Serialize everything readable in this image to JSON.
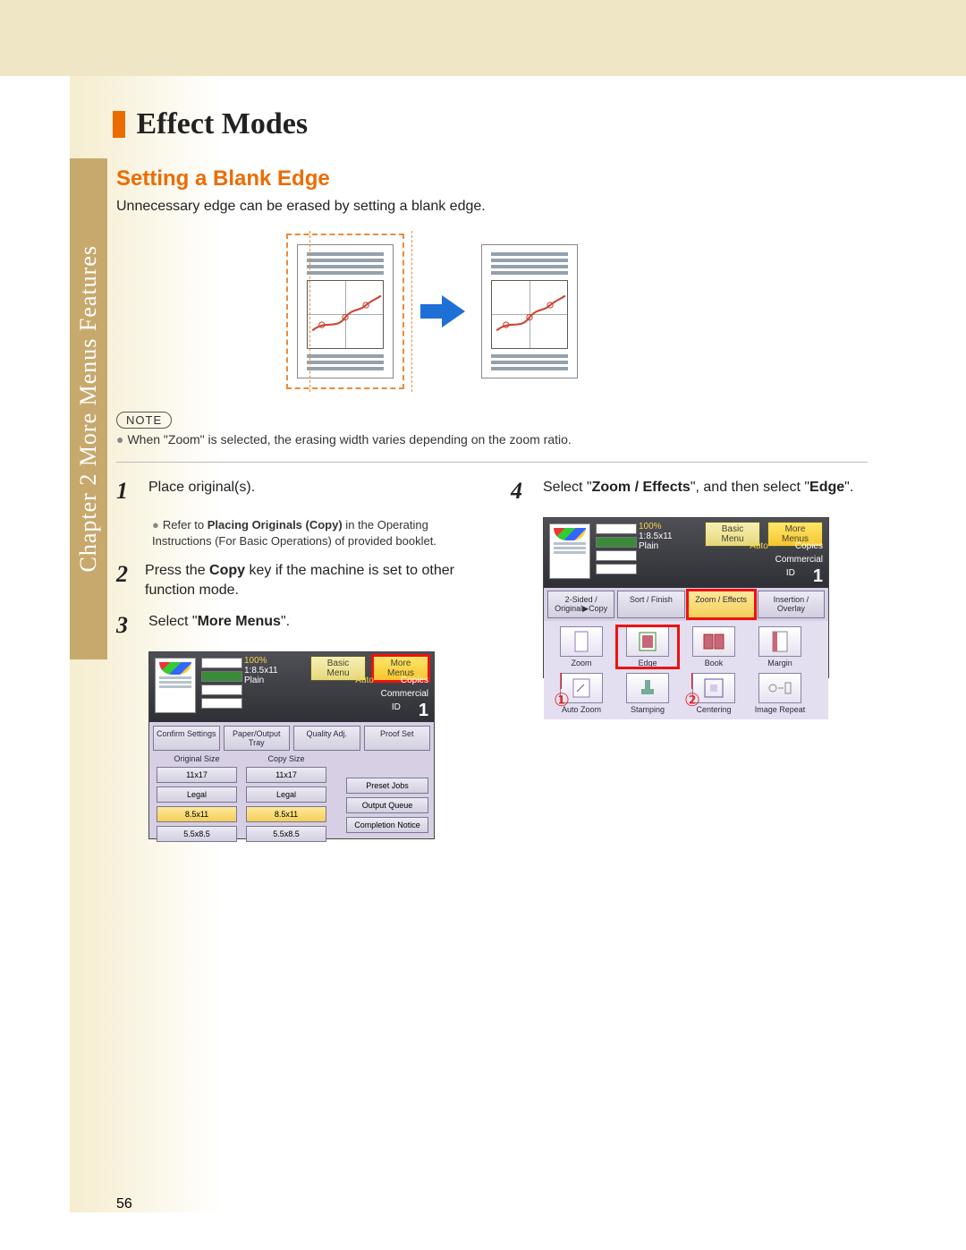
{
  "chapter_tab": "Chapter 2    More Menus Features",
  "heading": "Effect Modes",
  "subheading": "Setting a Blank Edge",
  "intro": "Unnecessary edge can be erased by setting a blank edge.",
  "note_badge": "NOTE",
  "note_line": "When \"Zoom\" is selected, the erasing width varies depending on the zoom ratio.",
  "steps": {
    "s1": {
      "num": "1",
      "text": "Place original(s)."
    },
    "s1_sub_prefix": "Refer to ",
    "s1_sub_strong": "Placing Originals (Copy)",
    "s1_sub_suffix": " in the Operating Instructions (For Basic Operations) of provided booklet.",
    "s2": {
      "num": "2",
      "text_a": "Press the ",
      "text_bold": "Copy",
      "text_b": " key if the machine is set to other function mode."
    },
    "s3": {
      "num": "3",
      "text_a": "Select \"",
      "text_bold": "More Menus",
      "text_b": "\"."
    },
    "s4": {
      "num": "4",
      "text_a": "Select \"",
      "text_bold1": "Zoom / Effects",
      "text_mid": "\", and then select \"",
      "text_bold2": "Edge",
      "text_b": "\"."
    }
  },
  "screenshot_a": {
    "zoom": "100%",
    "paper": "1:8.5x11",
    "plain": "Plain",
    "basic_menu": "Basic Menu",
    "more_menus": "More Menus",
    "auto": "Auto",
    "copies": "Copies",
    "commercial": "Commercial",
    "id": "ID",
    "count": "1",
    "row": {
      "confirm": "Confirm Settings",
      "paper_output": "Paper/Output Tray",
      "quality": "Quality Adj.",
      "proof": "Proof Set"
    },
    "orig_label": "Original Size",
    "copy_label": "Copy Size",
    "sizes": [
      "11x17",
      "Legal",
      "8.5x11",
      "5.5x8.5"
    ],
    "right_list": [
      "Preset Jobs",
      "Output Queue",
      "Completion Notice"
    ]
  },
  "screenshot_b": {
    "zoom": "100%",
    "paper": "1:8.5x11",
    "plain": "Plain",
    "basic_menu": "Basic Menu",
    "more_menus": "More Menus",
    "auto": "Auto",
    "copies": "Copies",
    "commercial": "Commercial",
    "id": "ID",
    "count": "1",
    "tabs": {
      "t1": "2-Sided / Original▶Copy",
      "t2": "Sort / Finish",
      "t3": "Zoom / Effects",
      "t4": "Insertion / Overlay"
    },
    "effects": {
      "zoom": "Zoom",
      "edge": "Edge",
      "book": "Book",
      "margin": "Margin",
      "auto_zoom": "Auto Zoom",
      "stamping": "Stamping",
      "centering": "Centering",
      "image_repeat": "Image Repeat"
    }
  },
  "callouts": {
    "one": "①",
    "two": "②"
  },
  "page_number": "56"
}
